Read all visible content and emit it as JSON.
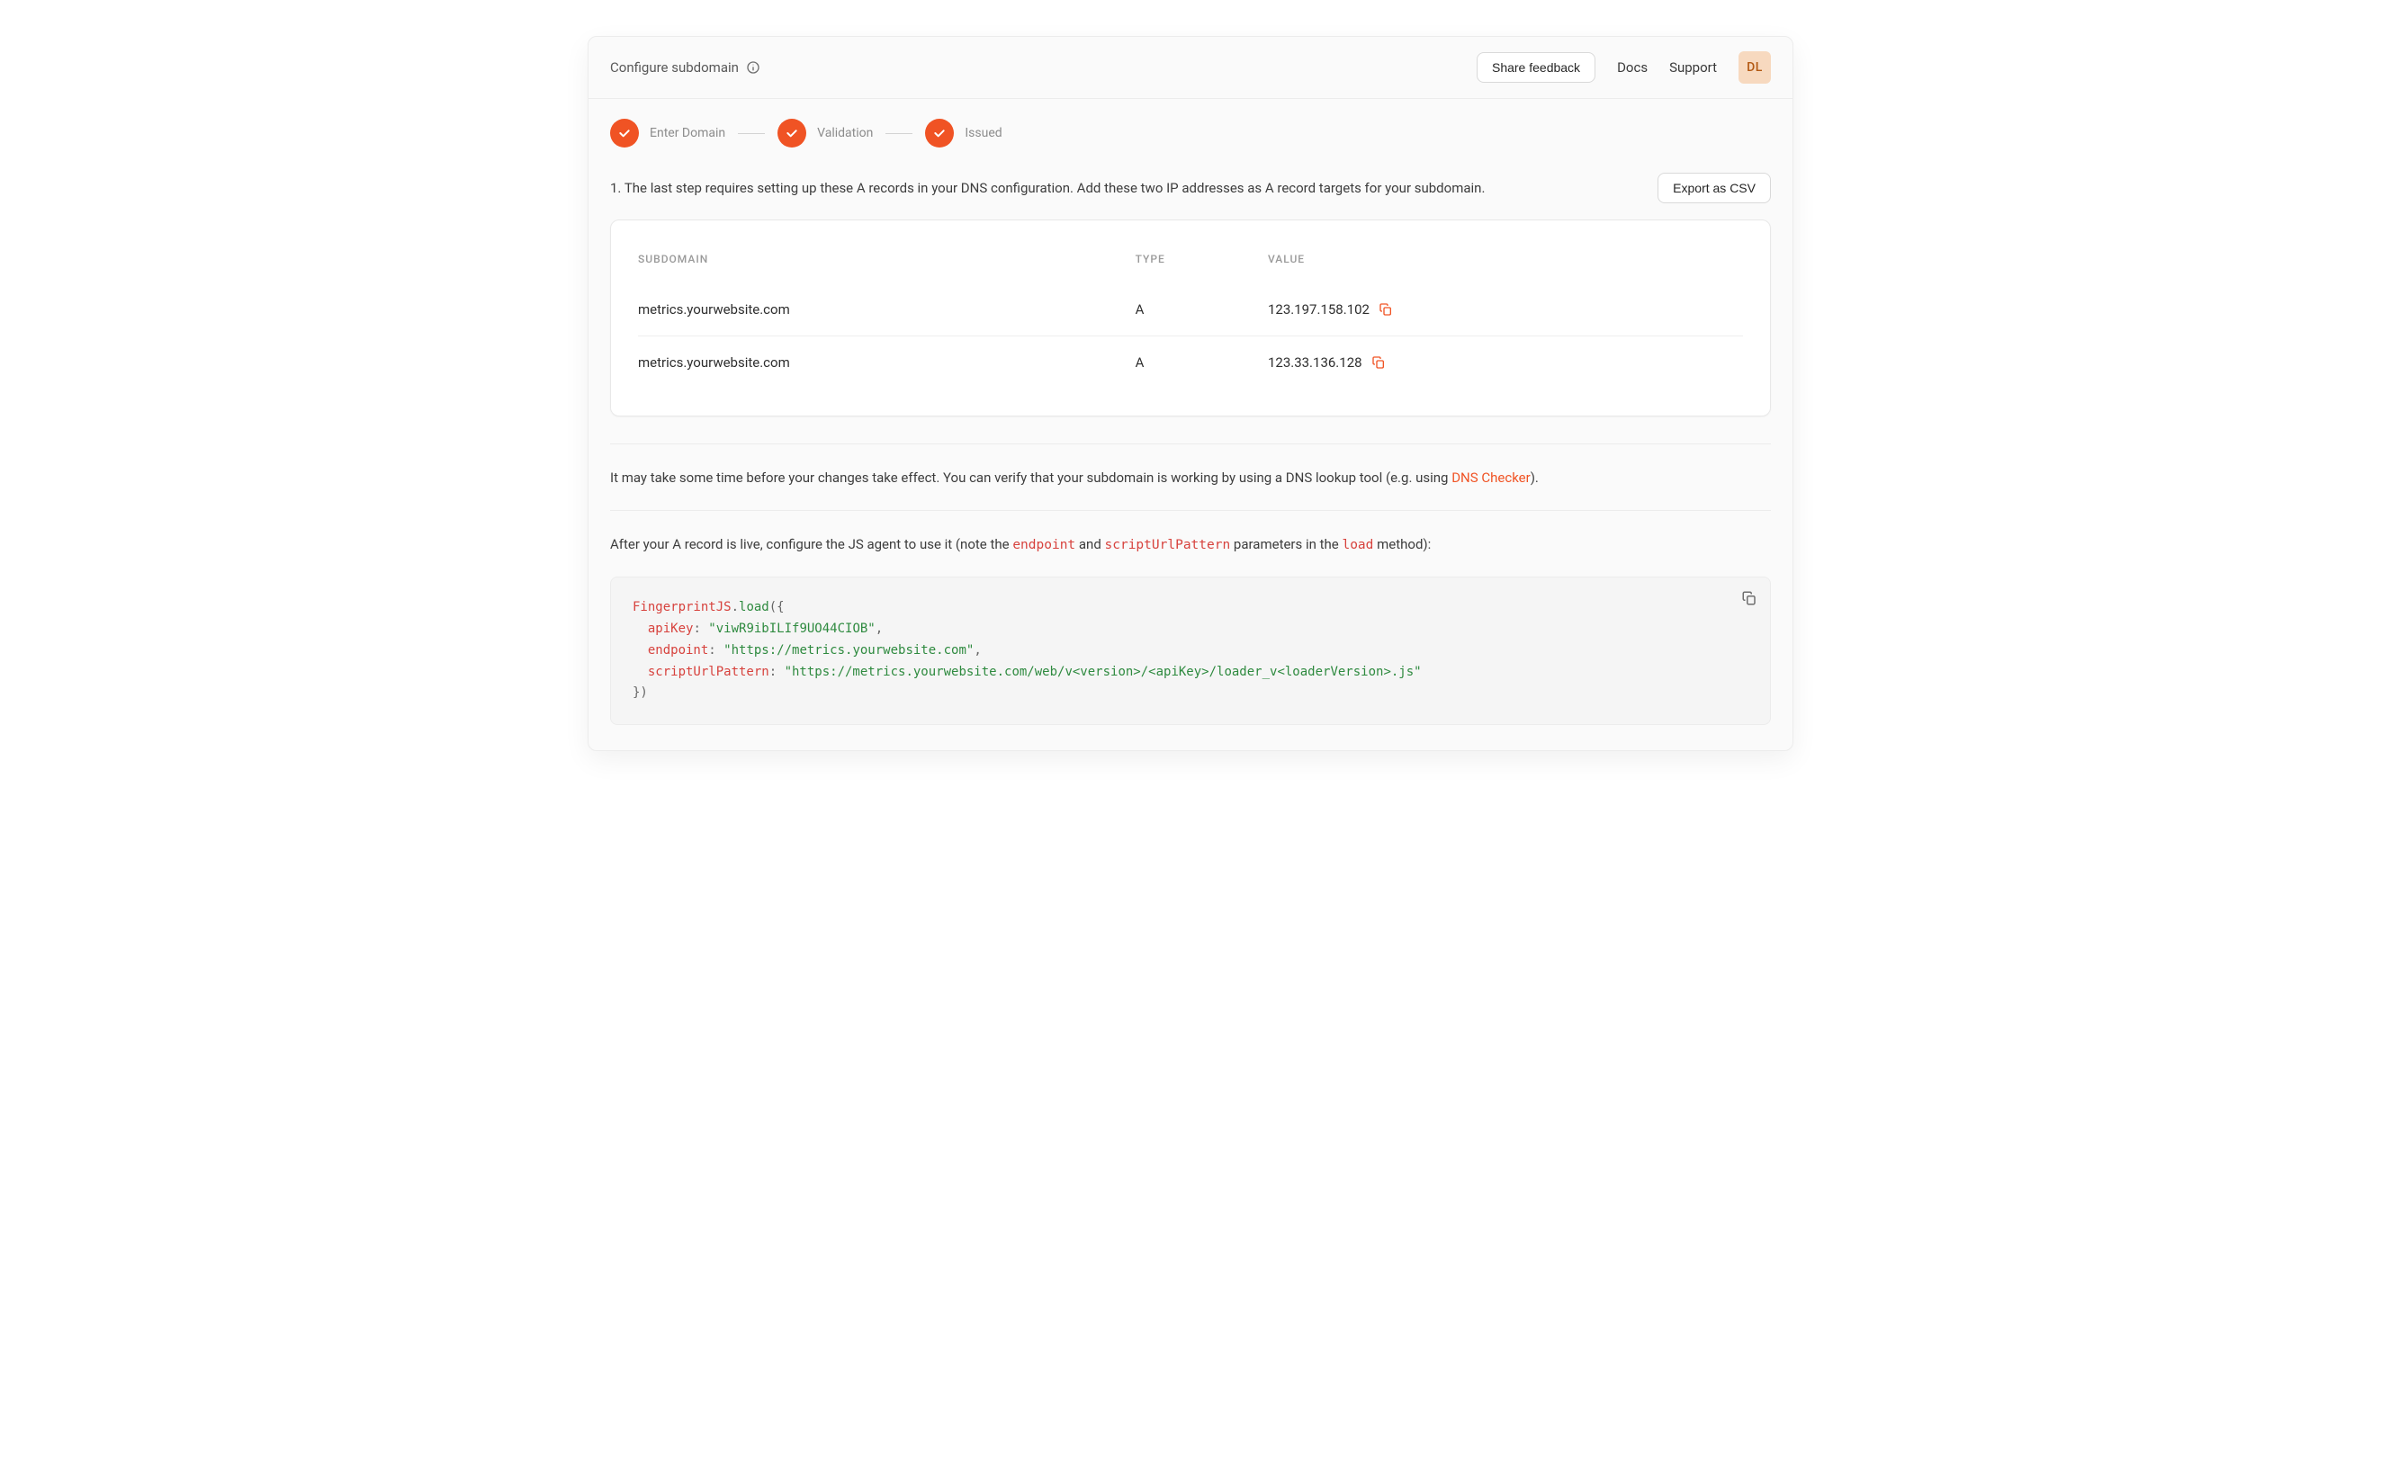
{
  "header": {
    "title": "Configure subdomain",
    "feedback": "Share feedback",
    "docs": "Docs",
    "support": "Support",
    "avatar": "DL"
  },
  "steps": [
    {
      "label": "Enter Domain",
      "done": true
    },
    {
      "label": "Validation",
      "done": true
    },
    {
      "label": "Issued",
      "done": true
    }
  ],
  "instruction": "1. The last step requires setting up these A records in your DNS configuration. Add these two IP addresses as A record targets for your subdomain.",
  "exportCsv": "Export as CSV",
  "table": {
    "headers": {
      "subdomain": "SUBDOMAIN",
      "type": "TYPE",
      "value": "VALUE"
    },
    "rows": [
      {
        "subdomain": "metrics.yourwebsite.com",
        "type": "A",
        "value": "123.197.158.102"
      },
      {
        "subdomain": "metrics.yourwebsite.com",
        "type": "A",
        "value": "123.33.136.128"
      }
    ]
  },
  "dnsNote": {
    "prefix": "It may take some time before your changes take effect. You can verify that your subdomain is working by using a DNS lookup tool (e.g. using ",
    "linkText": "DNS Checker",
    "suffix": ")."
  },
  "jsAgentNote": {
    "prefix": "After your A record is live, configure the JS agent to use it (note the ",
    "code1": "endpoint",
    "mid1": " and ",
    "code2": "scriptUrlPattern",
    "mid2": " parameters in the ",
    "code3": "load",
    "suffix": " method):"
  },
  "code": {
    "className": "FingerprintJS",
    "funcName": "load",
    "apiKeyKey": "apiKey",
    "apiKeyVal": "\"viwR9ibILIf9UO44CIOB\"",
    "endpointKey": "endpoint",
    "endpointVal": "\"https://metrics.yourwebsite.com\"",
    "scriptKey": "scriptUrlPattern",
    "scriptVal": "\"https://metrics.yourwebsite.com/web/v<version>/<apiKey>/loader_v<loaderVersion>.js\""
  },
  "colors": {
    "accent": "#f05324",
    "avatarBg": "#f7d9bf",
    "avatarFg": "#b35912"
  }
}
